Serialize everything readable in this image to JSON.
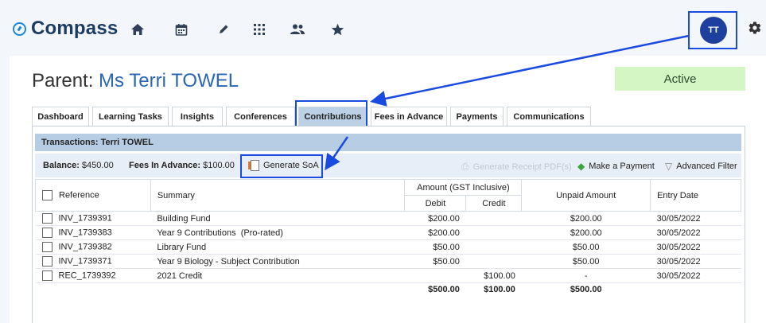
{
  "app": {
    "name": "Compass",
    "user_initials": "TT"
  },
  "nav_icons": [
    "home-icon",
    "calendar-icon",
    "pencil-icon",
    "grid-icon",
    "people-icon",
    "star-icon"
  ],
  "page": {
    "title_prefix": "Parent: ",
    "title_name": "Ms Terri TOWEL",
    "status": "Active"
  },
  "tabs": [
    {
      "label": "Dashboard",
      "active": false
    },
    {
      "label": "Learning Tasks",
      "active": false
    },
    {
      "label": "Insights",
      "active": false
    },
    {
      "label": "Conferences",
      "active": false
    },
    {
      "label": "Contributions",
      "active": true
    },
    {
      "label": "Fees in Advance",
      "active": false
    },
    {
      "label": "Payments",
      "active": false
    },
    {
      "label": "Communications",
      "active": false
    }
  ],
  "panel": {
    "header": "Transactions: Terri TOWEL",
    "balance_label": "Balance:",
    "balance_value": "$450.00",
    "fees_label": "Fees In Advance:",
    "fees_value": "$100.00",
    "generate_soa": "Generate SoA",
    "generate_receipt": "Generate Receipt PDF(s)",
    "make_payment": "Make a Payment",
    "advanced_filter": "Advanced Filter"
  },
  "table": {
    "headers": {
      "reference": "Reference",
      "summary": "Summary",
      "amount_group": "Amount (GST Inclusive)",
      "debit": "Debit",
      "credit": "Credit",
      "unpaid": "Unpaid Amount",
      "entry_date": "Entry Date"
    },
    "rows": [
      {
        "reference": "INV_1739391",
        "summary": "Building Fund",
        "debit": "$200.00",
        "credit": "",
        "unpaid": "$200.00",
        "date": "30/05/2022"
      },
      {
        "reference": "INV_1739383",
        "summary": "Year 9 Contributions  (Pro-rated)",
        "debit": "$200.00",
        "credit": "",
        "unpaid": "$200.00",
        "date": "30/05/2022"
      },
      {
        "reference": "INV_1739382",
        "summary": "Library Fund",
        "debit": "$50.00",
        "credit": "",
        "unpaid": "$50.00",
        "date": "30/05/2022"
      },
      {
        "reference": "INV_1739371",
        "summary": "Year 9 Biology - Subject Contribution",
        "debit": "$50.00",
        "credit": "",
        "unpaid": "$50.00",
        "date": "30/05/2022"
      },
      {
        "reference": "REC_1739392",
        "summary": "2021 Credit",
        "debit": "",
        "credit": "$100.00",
        "unpaid": "-",
        "date": "30/05/2022"
      }
    ],
    "totals": {
      "debit": "$500.00",
      "credit": "$100.00",
      "unpaid": "$500.00"
    }
  },
  "colors": {
    "highlight": "#1a4be0",
    "brand_blue": "#1d3c63",
    "status_bg": "#d4f5c4",
    "header_bg": "#b7cde4"
  }
}
